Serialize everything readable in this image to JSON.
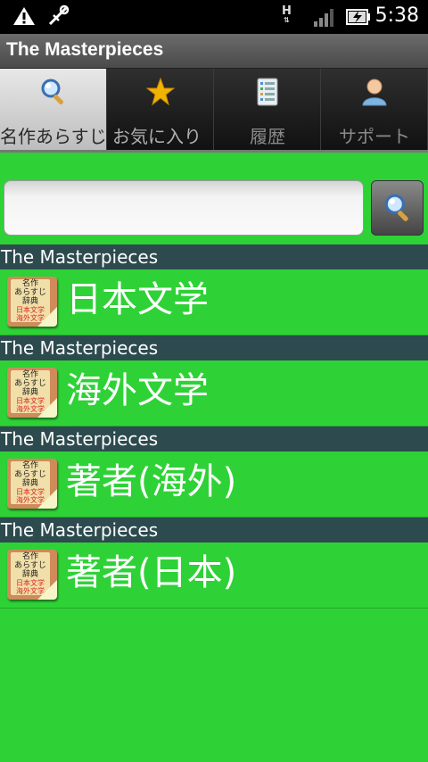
{
  "status_bar": {
    "time": "5:38",
    "network_label": "H",
    "icons": [
      "warning-icon",
      "usb-debug-icon",
      "signal-icon",
      "battery-charging-icon"
    ]
  },
  "title_bar": {
    "title": "The Masterpieces"
  },
  "tabs": [
    {
      "label": "名作あらすじ",
      "icon": "magnifier-icon",
      "selected": true
    },
    {
      "label": "お気に入り",
      "icon": "star-icon",
      "selected": false
    },
    {
      "label": "履歴",
      "icon": "list-icon",
      "selected": false
    },
    {
      "label": "サポート",
      "icon": "person-icon",
      "selected": false
    }
  ],
  "search": {
    "value": "",
    "placeholder": ""
  },
  "list": [
    {
      "section": "The Masterpieces",
      "label": "日本文学"
    },
    {
      "section": "The Masterpieces",
      "label": "海外文学"
    },
    {
      "section": "The Masterpieces",
      "label": "著者(海外)"
    },
    {
      "section": "The Masterpieces",
      "label": "著者(日本)"
    }
  ],
  "book_icon_text": {
    "line1": "名作",
    "line2": "あらすじ",
    "line3": "辞典",
    "line4": "日本文学",
    "line5": "海外文学"
  },
  "colors": {
    "background": "#2ed236",
    "section_header": "#2d4b4e",
    "title_bar": "#5a5a5a"
  }
}
